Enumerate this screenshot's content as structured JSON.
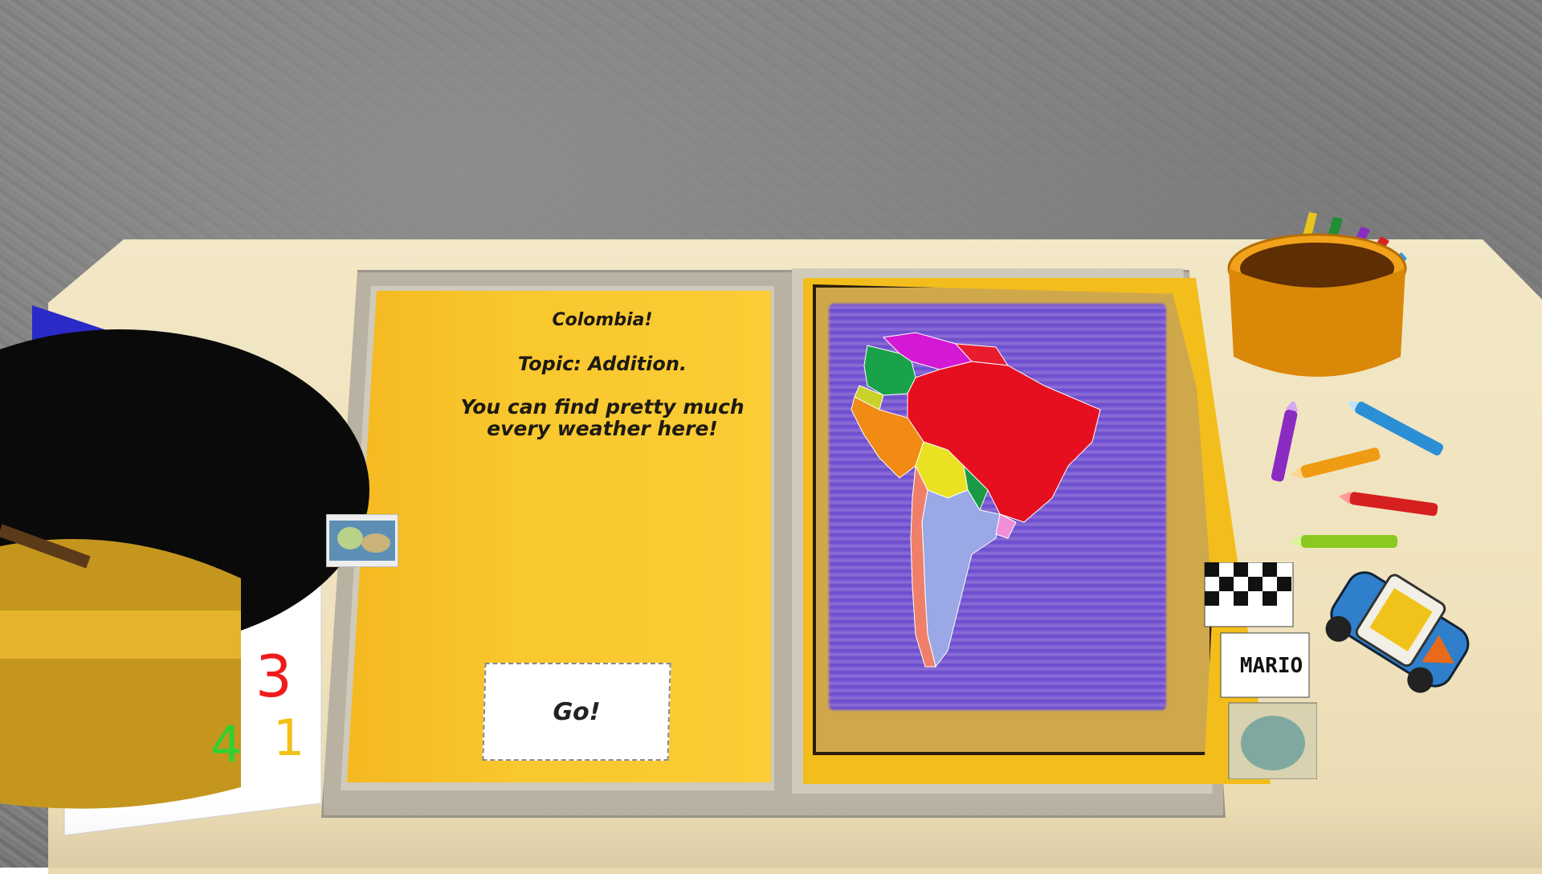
{
  "book": {
    "country_title": "Colombia!",
    "topic": "Topic: Addition.",
    "description": "You can find pretty much every weather here!",
    "go_label": "Go!"
  },
  "cards": {
    "name_card": "MARIO"
  },
  "drawing": {
    "numbers": [
      "3",
      "4",
      "1"
    ]
  },
  "colors": {
    "page_yellow": "#f9c72e",
    "map_scribble": "#6a4ef0",
    "tray_gray": "#b9b2a2",
    "desk": "#f2e7c6"
  }
}
